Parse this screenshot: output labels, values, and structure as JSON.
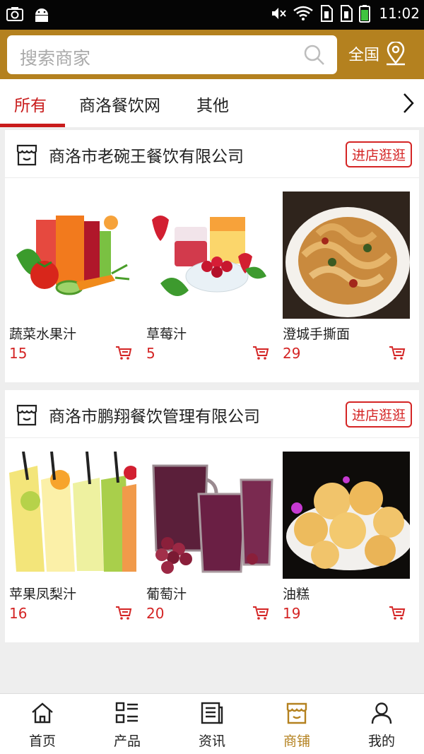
{
  "status_bar": {
    "time": "11:02"
  },
  "search": {
    "placeholder": "搜索商家",
    "region_label": "全国"
  },
  "tabs": [
    {
      "label": "所有",
      "active": true
    },
    {
      "label": "商洛餐饮网",
      "active": false
    },
    {
      "label": "其他",
      "active": false
    }
  ],
  "shops": [
    {
      "name": "商洛市老碗王餐饮有限公司",
      "enter_label": "进店逛逛",
      "products": [
        {
          "name": "蔬菜水果汁",
          "price": "15"
        },
        {
          "name": "草莓汁",
          "price": "5"
        },
        {
          "name": "澄城手撕面",
          "price": "29"
        }
      ]
    },
    {
      "name": "商洛市鹏翔餐饮管理有限公司",
      "enter_label": "进店逛逛",
      "products": [
        {
          "name": "苹果凤梨汁",
          "price": "16"
        },
        {
          "name": "葡萄汁",
          "price": "20"
        },
        {
          "name": "油糕",
          "price": "19"
        }
      ]
    }
  ],
  "bottom_nav": [
    {
      "label": "首页",
      "icon": "home-icon",
      "active": false
    },
    {
      "label": "产品",
      "icon": "grid-list-icon",
      "active": false
    },
    {
      "label": "资讯",
      "icon": "news-icon",
      "active": false
    },
    {
      "label": "商铺",
      "icon": "shop-icon",
      "active": true
    },
    {
      "label": "我的",
      "icon": "user-icon",
      "active": false
    }
  ],
  "colors": {
    "brand": "#b4811f",
    "accent_red": "#d42525",
    "tab_active": "#c91c1c"
  }
}
